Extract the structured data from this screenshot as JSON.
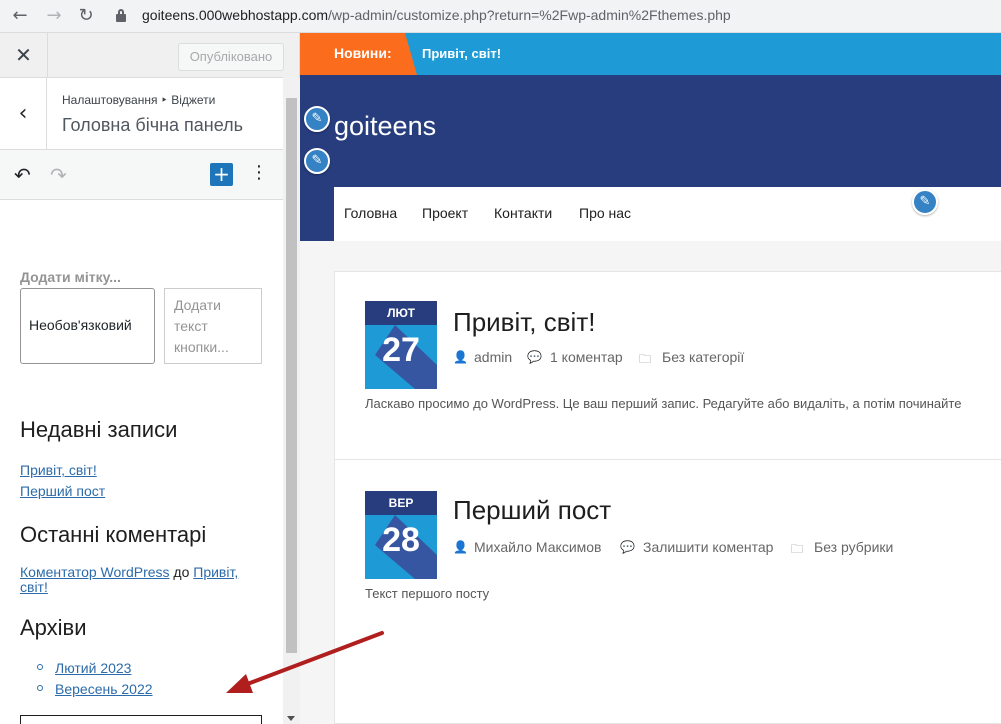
{
  "browser": {
    "url_domain": "goiteens.000webhostapp.com",
    "url_path": "/wp-admin/customize.php?return=%2Fwp-admin%2Fthemes.php"
  },
  "panel": {
    "close_icon": "close-icon",
    "publish_label": "Опубліковано",
    "breadcrumb": "Налаштовування ‣ Віджети",
    "section_title": "Головна бічна панель",
    "widgets": {
      "add_label": "Додати мітку...",
      "button_text": "Необов'язковий",
      "button_placeholder": "Додати текст кнопки...",
      "recent_posts_heading": "Недавні записи",
      "recent_posts": [
        "Привіт, світ!",
        "Перший пост"
      ],
      "recent_comments_heading": "Останні коментарі",
      "comment_author": "Коментатор WordPress",
      "comment_on": "до",
      "comment_post": "Привіт, світ!",
      "archives_heading": "Архіви",
      "archives": [
        "Лютий 2023",
        "Вересень 2022"
      ],
      "add_block": "+"
    }
  },
  "preview": {
    "news_label": "Новини:",
    "news_text": "Привіт, світ!",
    "site_title": "goiteens",
    "menu": [
      "Головна",
      "Проект",
      "Контакти",
      "Про нас"
    ],
    "posts": [
      {
        "month": "ЛЮТ",
        "day": "27",
        "title": "Привіт, світ!",
        "author": "admin",
        "comments": "1 коментар",
        "category": "Без категорії",
        "excerpt": "Ласкаво просимо до WordPress. Це ваш перший запис. Редагуйте або видаліть, а потім починайте"
      },
      {
        "month": "ВЕР",
        "day": "28",
        "title": "Перший пост",
        "author": "Михайло Максимов",
        "comments": "Залишити коментар",
        "category": "Без рубрики",
        "excerpt": "Текст першого посту"
      }
    ]
  },
  "colors": {
    "accent_blue": "#1e9bd7",
    "header_navy": "#273d7e",
    "news_orange": "#fb6d1c",
    "annotation_red": "#b01e1e"
  }
}
